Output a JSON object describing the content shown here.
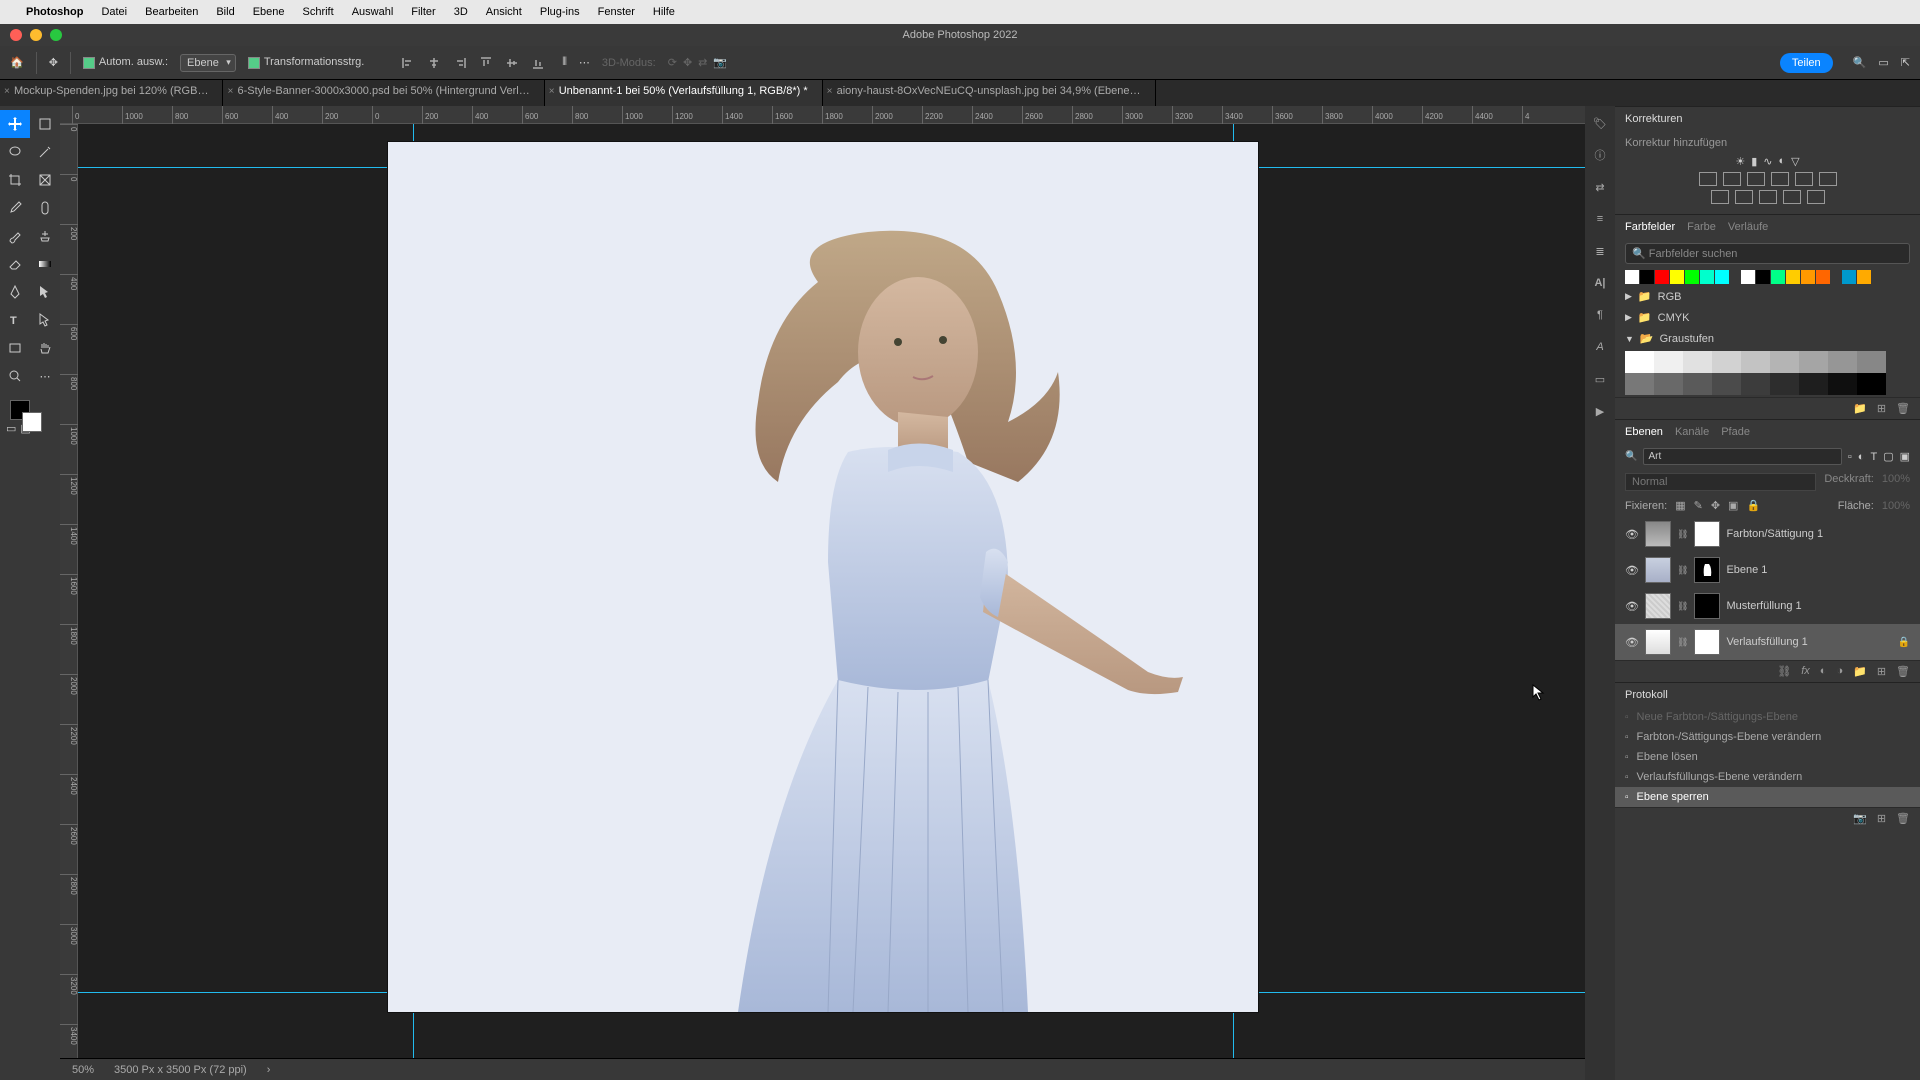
{
  "menubar": {
    "app": "Photoshop",
    "items": [
      "Datei",
      "Bearbeiten",
      "Bild",
      "Ebene",
      "Schrift",
      "Auswahl",
      "Filter",
      "3D",
      "Ansicht",
      "Plug-ins",
      "Fenster",
      "Hilfe"
    ]
  },
  "window": {
    "title": "Adobe Photoshop 2022"
  },
  "optionbar": {
    "auto": "Autom. ausw.:",
    "target": "Ebene",
    "transform": "Transformationsstrg.",
    "threed": "3D-Modus:",
    "share": "Teilen"
  },
  "tabs": [
    {
      "label": "Mockup-Spenden.jpg bei 120% (RGB…",
      "active": false
    },
    {
      "label": "6-Style-Banner-3000x3000.psd bei 50% (Hintergrund Verl…",
      "active": false
    },
    {
      "label": "Unbenannt-1 bei 50% (Verlaufsfüllung 1, RGB/8*) *",
      "active": true
    },
    {
      "label": "aiony-haust-8OxVecNEuCQ-unsplash.jpg bei 34,9% (Ebene…",
      "active": false
    }
  ],
  "ruler": {
    "h": [
      "0",
      "1000",
      "800",
      "600",
      "400",
      "200",
      "0",
      "200",
      "400",
      "600",
      "800",
      "1000",
      "1200",
      "1400",
      "1600",
      "1800",
      "2000",
      "2200",
      "2400",
      "2600",
      "2800",
      "3000",
      "3200",
      "3400",
      "3600",
      "3800",
      "4000",
      "4200",
      "4400",
      "4"
    ],
    "v": [
      "0",
      "0",
      "200",
      "400",
      "600",
      "800",
      "1000",
      "1200",
      "1400",
      "1600",
      "1800",
      "2000",
      "2200",
      "2400",
      "2600",
      "2800",
      "3000",
      "3200",
      "3400"
    ]
  },
  "status": {
    "zoom": "50%",
    "dims": "3500 Px x 3500 Px (72 ppi)"
  },
  "panels": {
    "adjustments": {
      "title": "Korrekturen",
      "add": "Korrektur hinzufügen"
    },
    "swatches": {
      "tabs": [
        "Farbfelder",
        "Farbe",
        "Verläufe"
      ],
      "search": "Farbfelder suchen",
      "folders": [
        "RGB",
        "CMYK",
        "Graustufen"
      ],
      "row1": [
        "#ffffff",
        "#000000",
        "#ff0000",
        "#ffff00",
        "#00ff00",
        "#00ffcc",
        "#00ffff"
      ],
      "row1b": [
        "#ffffff",
        "#000000",
        "#00ff88",
        "#ffcc00",
        "#ff9900",
        "#ff6600"
      ],
      "row1c": [
        "#0099cc",
        "#ffaa00"
      ]
    },
    "layers": {
      "tabs": [
        "Ebenen",
        "Kanäle",
        "Pfade"
      ],
      "filter": "Art",
      "blend": "Normal",
      "opacity_l": "Deckkraft:",
      "opacity": "100%",
      "lock_l": "Fixieren:",
      "fill_l": "Fläche:",
      "fill": "100%",
      "items": [
        {
          "name": "Farbton/Sättigung 1",
          "locked": false,
          "type": "hue"
        },
        {
          "name": "Ebene 1",
          "locked": false,
          "type": "img"
        },
        {
          "name": "Musterfüllung 1",
          "locked": false,
          "type": "pat"
        },
        {
          "name": "Verlaufsfüllung 1",
          "locked": true,
          "type": "grad",
          "selected": true
        }
      ]
    },
    "history": {
      "title": "Protokoll",
      "items": [
        {
          "name": "Neue Farbton-/Sättigungs-Ebene",
          "dim": true
        },
        {
          "name": "Farbton-/Sättigungs-Ebene verändern",
          "dim": false
        },
        {
          "name": "Ebene lösen",
          "dim": false
        },
        {
          "name": "Verlaufsfüllungs-Ebene verändern",
          "dim": false
        },
        {
          "name": "Ebene sperren",
          "dim": false,
          "selected": true
        }
      ]
    }
  }
}
